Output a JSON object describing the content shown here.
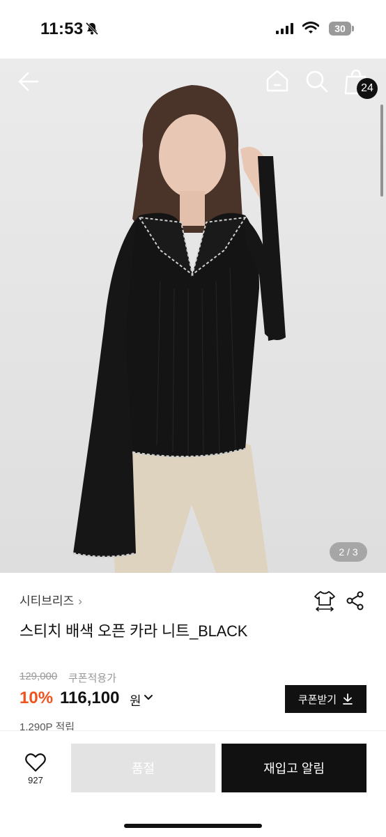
{
  "status_bar": {
    "time": "11:53",
    "battery": "30"
  },
  "header": {
    "cart_count": "24"
  },
  "gallery": {
    "counter": "2 / 3"
  },
  "product": {
    "brand": "시티브리즈",
    "title": "스티치 배색 오픈 카라 니트_BLACK",
    "original_price": "129,000",
    "coupon_note": "쿠폰적용가",
    "discount": "10%",
    "sale_price": "116,100",
    "currency": "원",
    "points": "1,290P 적립"
  },
  "actions": {
    "coupon_label": "쿠폰받기",
    "likes": "927",
    "soldout_label": "품절",
    "restock_label": "재입고 알림"
  },
  "colors": {
    "accent": "#f0531e",
    "primary": "#111111",
    "disabled": "#e3e3e3"
  },
  "icons": [
    "bell-slash-icon",
    "signal-icon",
    "wifi-icon",
    "back-arrow-icon",
    "home-icon",
    "search-icon",
    "shopping-bag-icon",
    "size-guide-icon",
    "share-icon",
    "chevron-down-icon",
    "download-icon",
    "heart-icon"
  ]
}
